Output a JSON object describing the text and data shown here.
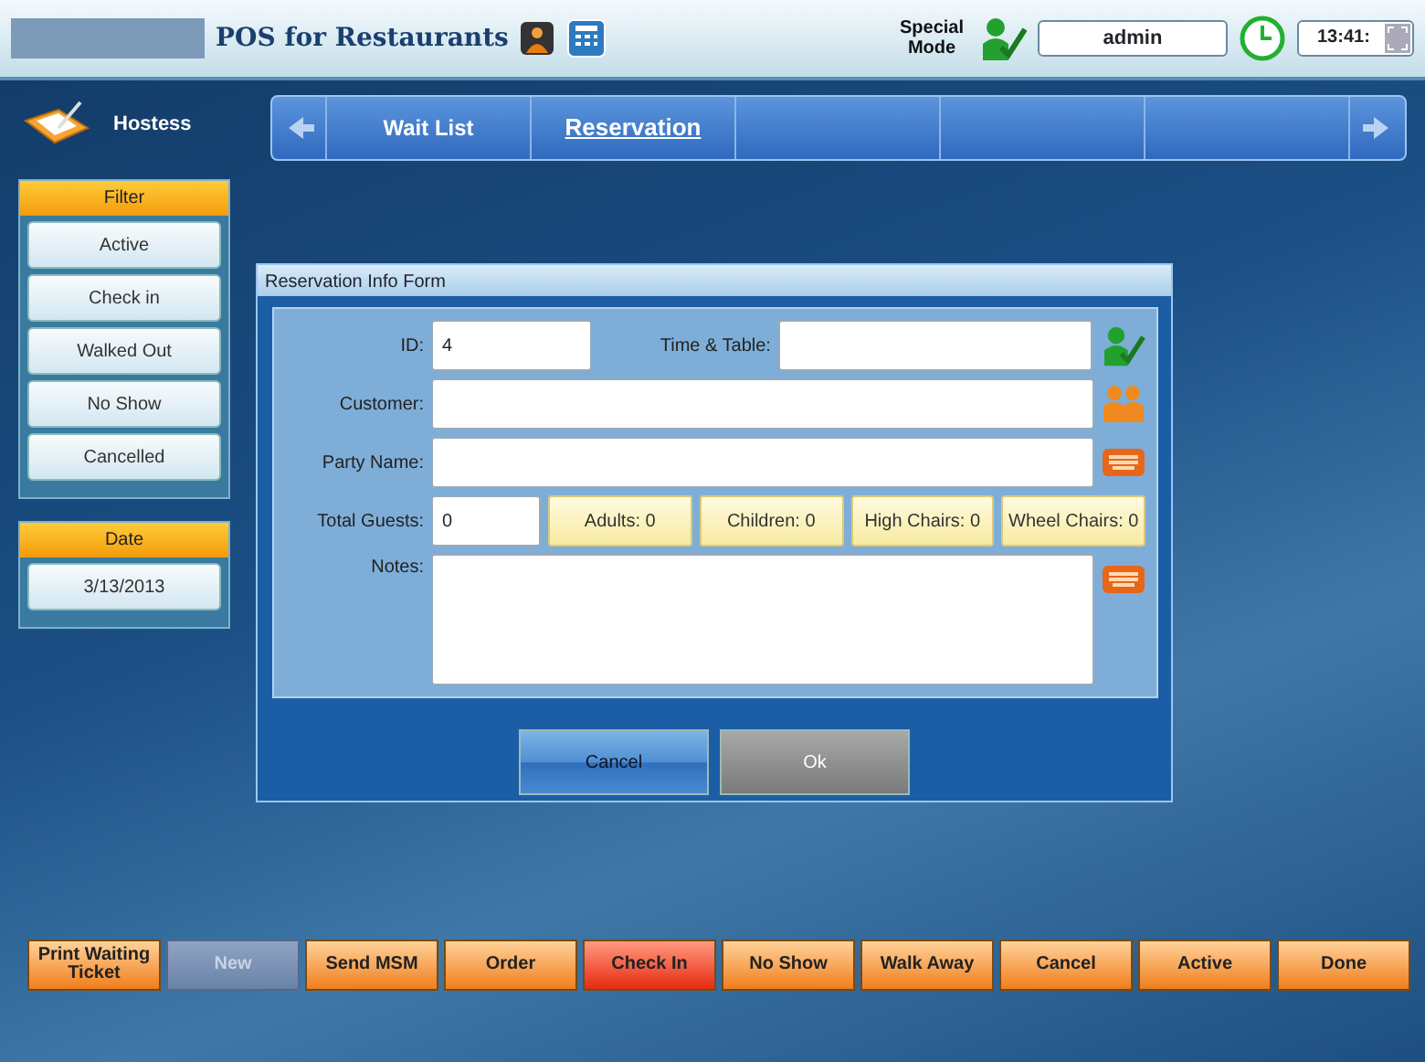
{
  "header": {
    "app_title": "POS for Restaurants",
    "mode_label": "Special Mode",
    "user": "admin",
    "time": "13:41:"
  },
  "sidebar": {
    "title": "Hostess",
    "filter": {
      "title": "Filter",
      "items": [
        {
          "label": "Active"
        },
        {
          "label": "Check in"
        },
        {
          "label": "Walked Out"
        },
        {
          "label": "No Show"
        },
        {
          "label": "Cancelled"
        }
      ]
    },
    "date": {
      "title": "Date",
      "value": "3/13/2013"
    }
  },
  "tabs": [
    {
      "label": "Wait List",
      "selected": false
    },
    {
      "label": "Reservation",
      "selected": true
    }
  ],
  "dialog": {
    "title": "Reservation Info Form",
    "id": {
      "label": "ID:",
      "value": "4"
    },
    "time_table": {
      "label": "Time & Table:"
    },
    "customer": {
      "label": "Customer:"
    },
    "party_name": {
      "label": "Party Name:"
    },
    "total_guests": {
      "label": "Total Guests:",
      "value": "0"
    },
    "counters": [
      "Adults: 0",
      "Children: 0",
      "High Chairs: 0",
      "Wheel Chairs: 0"
    ],
    "notes": {
      "label": "Notes:"
    },
    "buttons": [
      {
        "label": "Cancel",
        "disabled": false
      },
      {
        "label": "Ok",
        "disabled": true
      }
    ]
  },
  "actions": [
    {
      "label": "Print Waiting Ticket",
      "kind": "normal"
    },
    {
      "label": "New",
      "kind": "disabled"
    },
    {
      "label": "Send MSM",
      "kind": "normal"
    },
    {
      "label": "Order",
      "kind": "normal"
    },
    {
      "label": "Check In",
      "kind": "alert"
    },
    {
      "label": "No Show",
      "kind": "normal"
    },
    {
      "label": "Walk Away",
      "kind": "normal"
    },
    {
      "label": "Cancel",
      "kind": "normal"
    },
    {
      "label": "Active",
      "kind": "normal"
    },
    {
      "label": "Done",
      "kind": "normal"
    }
  ]
}
